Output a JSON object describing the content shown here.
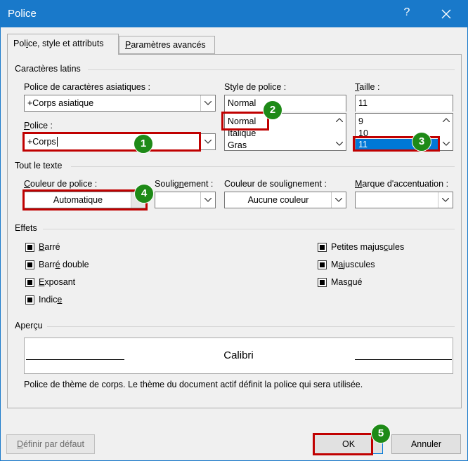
{
  "window": {
    "title": "Police",
    "help": "?"
  },
  "tabs": [
    {
      "label_pre": "Pol",
      "label_u": "i",
      "label_post": "ce, style et attributs"
    },
    {
      "label_pre": "",
      "label_u": "P",
      "label_post": "aramètres avancés"
    }
  ],
  "latin": {
    "group": "Caractères latins",
    "asian_label": "Police de caractères asiatiques :",
    "asian_value": "+Corps asiatique",
    "police_label_u": "P",
    "police_label_post": "olice  :",
    "police_value": "+Corps",
    "style_label": "Style de police :",
    "style_value": "Normal",
    "style_items": [
      "Normal",
      "Italique",
      "Gras"
    ],
    "size_label_u": "T",
    "size_label_post": "aille :",
    "size_value": "11",
    "size_items": [
      "9",
      "10",
      "11"
    ]
  },
  "all_text": {
    "group": "Tout le texte",
    "color_label_u": "C",
    "color_label_post": "ouleur de police :",
    "color_value": "Automatique",
    "underline_label_pre": "Soulig",
    "underline_label_u": "n",
    "underline_label_post": "ement :",
    "underline_color_label": "Couleur de soulignement :",
    "underline_color_value": "Aucune couleur",
    "accent_label_u": "M",
    "accent_label_post": "arque d'accentuation :"
  },
  "effects": {
    "group": "Effets",
    "left": [
      {
        "pre": "",
        "u": "B",
        "post": "arré"
      },
      {
        "pre": "Barr",
        "u": "é",
        "post": " double"
      },
      {
        "pre": "",
        "u": "E",
        "post": "xposant"
      },
      {
        "pre": "Indic",
        "u": "e",
        "post": ""
      }
    ],
    "right": [
      {
        "pre": "Petites majus",
        "u": "c",
        "post": "ules"
      },
      {
        "pre": "M",
        "u": "a",
        "post": "juscules"
      },
      {
        "pre": "Mas",
        "u": "q",
        "post": "ué"
      }
    ]
  },
  "preview": {
    "group": "Aperçu",
    "sample": "Calibri",
    "description": "Police de thème de corps. Le thème du document actif définit la police qui sera utilisée."
  },
  "buttons": {
    "default_pre": "",
    "default_u": "D",
    "default_post": "éfinir par défaut",
    "ok": "OK",
    "cancel": "Annuler"
  },
  "badges": [
    "1",
    "2",
    "3",
    "4",
    "5"
  ],
  "colors": {
    "titlebar": "#1979ca",
    "highlight": "#c00000",
    "badge": "#1e8a17",
    "selection": "#0078d7"
  }
}
